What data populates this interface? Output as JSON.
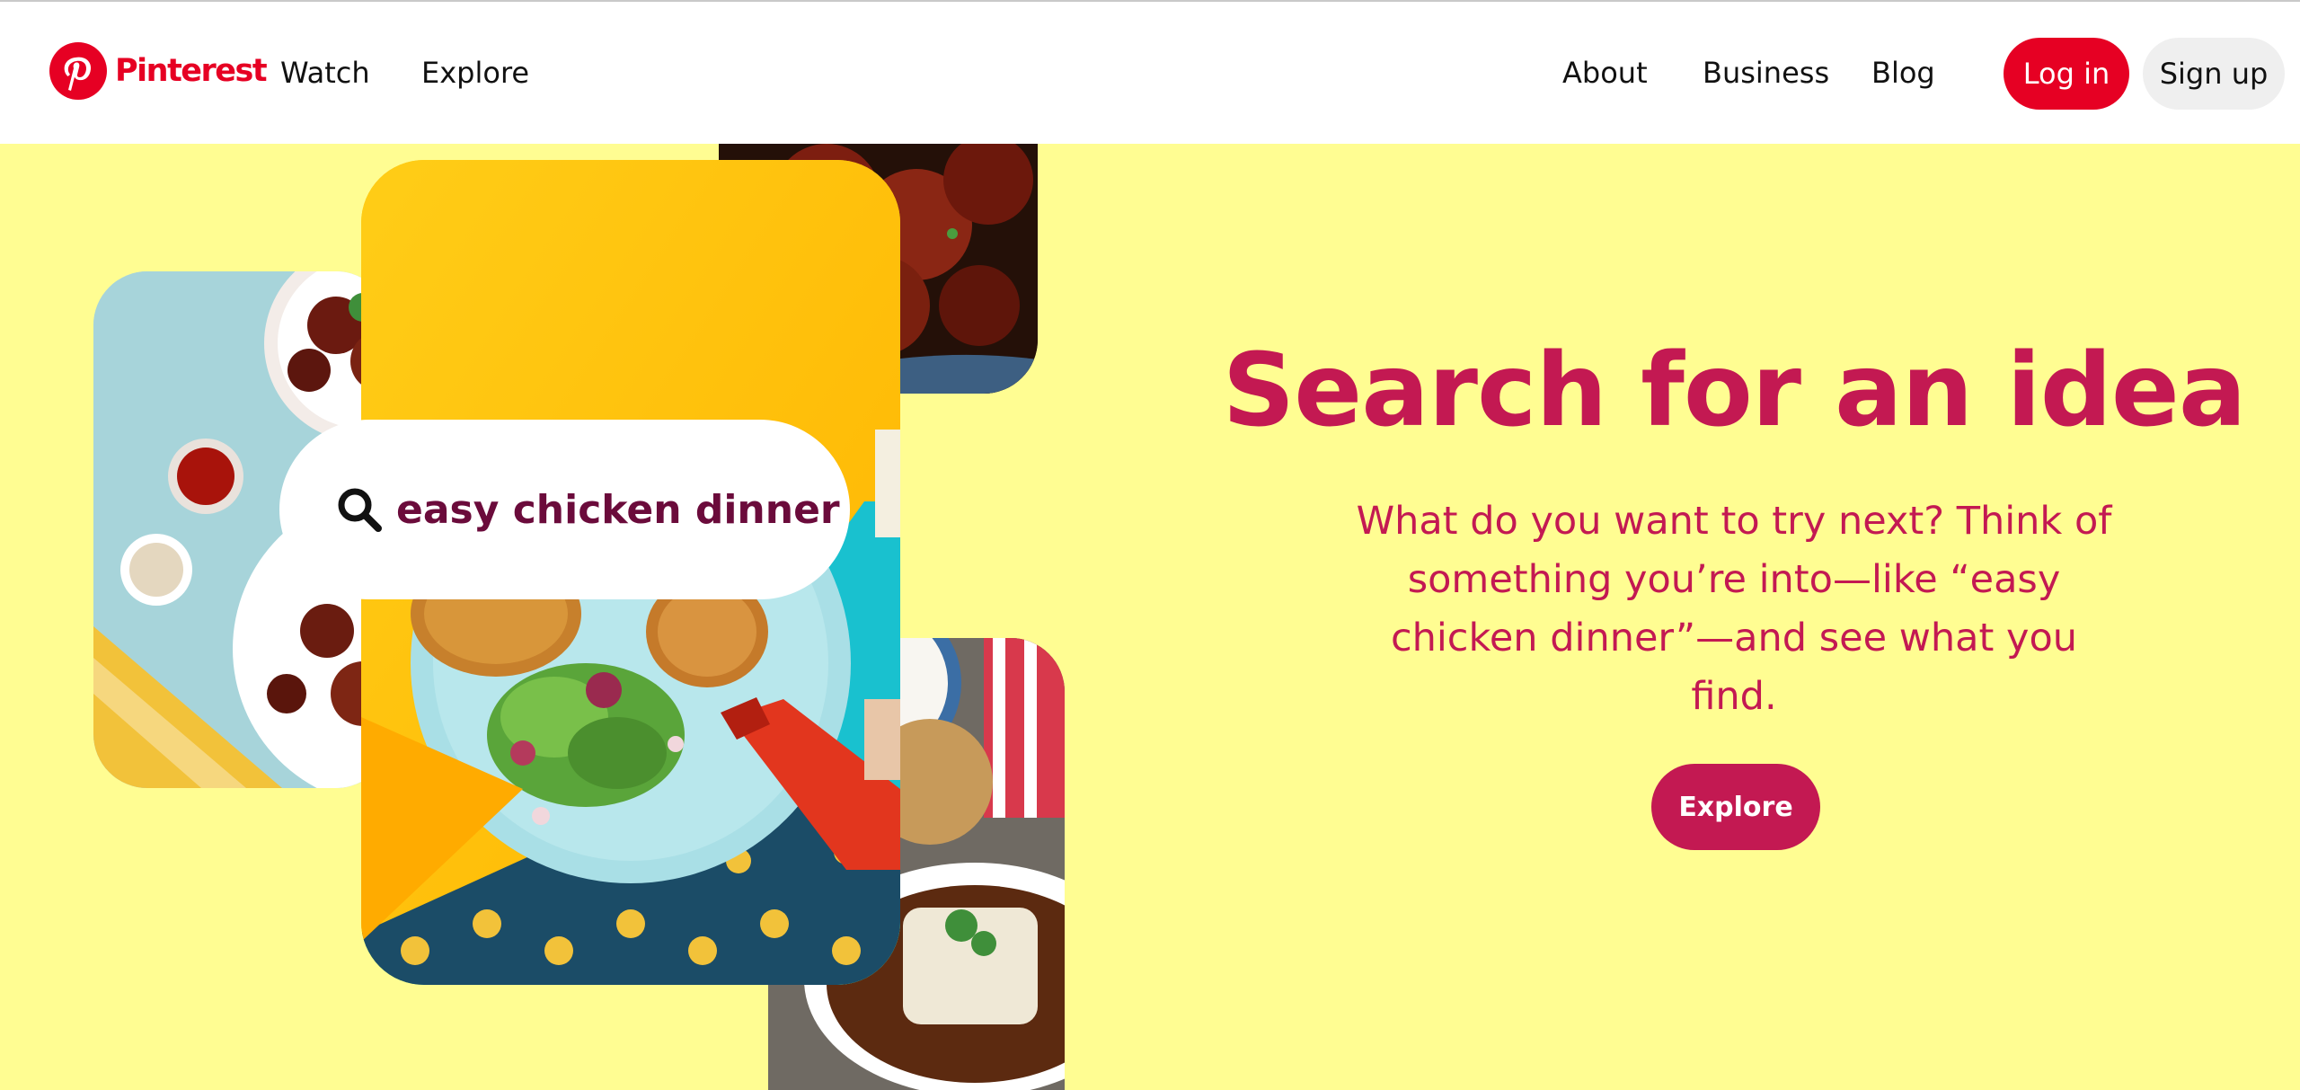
{
  "header": {
    "brand": "Pinterest",
    "nav_left": [
      "Watch",
      "Explore"
    ],
    "nav_right": [
      "About",
      "Business",
      "Blog"
    ],
    "login_label": "Log in",
    "signup_label": "Sign up"
  },
  "hero": {
    "search_query": "easy chicken dinner",
    "title": "Search for an idea",
    "subtitle": "What do you want to try next? Think of something you’re into—like “easy chicken dinner”—and see what you find.",
    "explore_label": "Explore"
  },
  "colors": {
    "brand_red": "#e60023",
    "accent_crimson": "#c31952",
    "background_yellow": "#fffd92",
    "search_text": "#6b0b3b"
  },
  "icons": {
    "logo": "pinterest-logo-icon",
    "search": "search-icon"
  }
}
